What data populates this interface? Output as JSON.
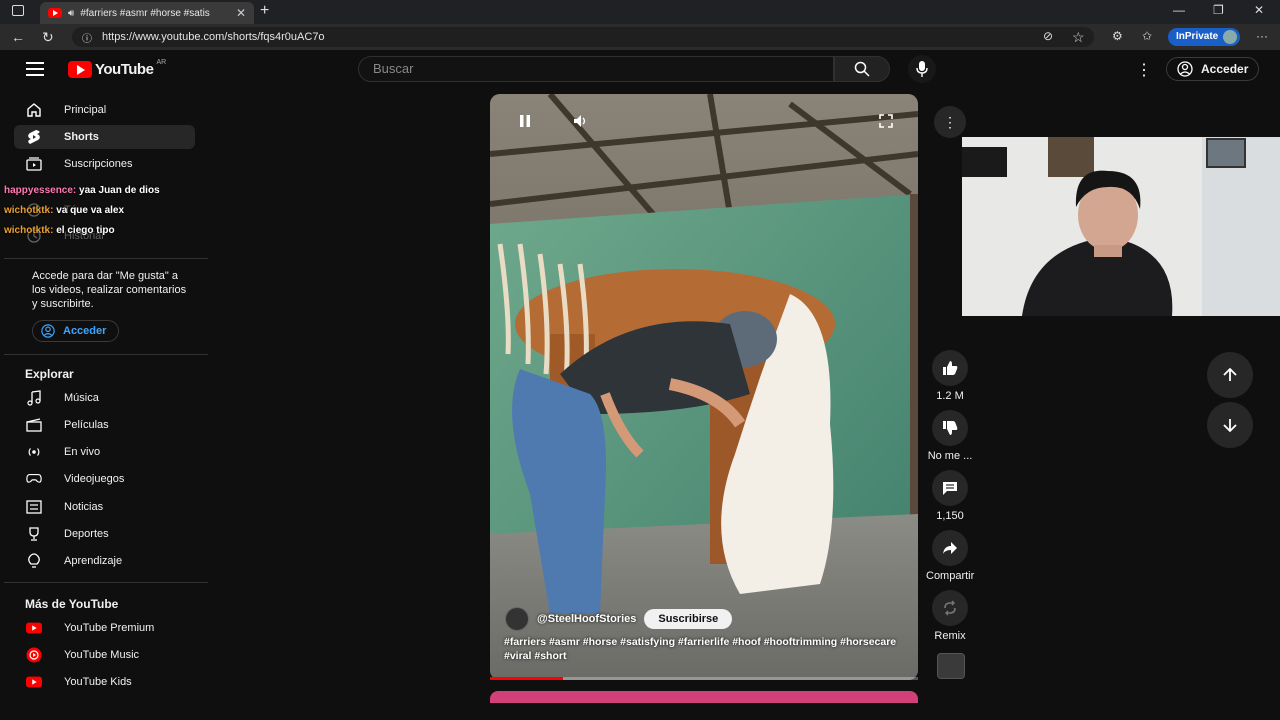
{
  "browser": {
    "tab_title": "#farriers #asmr #horse #satis",
    "url": "https://www.youtube.com/shorts/fqs4r0uAC7o",
    "inprivate_label": "InPrivate"
  },
  "header": {
    "logo_text": "YouTube",
    "country_code": "AR",
    "search_placeholder": "Buscar",
    "signin_label": "Acceder"
  },
  "sidebar": {
    "items": [
      {
        "label": "Principal",
        "icon": "home-icon"
      },
      {
        "label": "Shorts",
        "icon": "shorts-icon"
      },
      {
        "label": "Suscripciones",
        "icon": "subscriptions-icon"
      },
      {
        "label": "Tú",
        "icon": "you-icon"
      },
      {
        "label": "Historial",
        "icon": "history-icon"
      }
    ],
    "login_prompt": "Accede para dar \"Me gusta\" a los videos, realizar comentarios y suscribirte.",
    "login_button": "Acceder",
    "explore_title": "Explorar",
    "explore": [
      {
        "label": "Música",
        "icon": "music-icon"
      },
      {
        "label": "Películas",
        "icon": "movies-icon"
      },
      {
        "label": "En vivo",
        "icon": "live-icon"
      },
      {
        "label": "Videojuegos",
        "icon": "gaming-icon"
      },
      {
        "label": "Noticias",
        "icon": "news-icon"
      },
      {
        "label": "Deportes",
        "icon": "sports-icon"
      },
      {
        "label": "Aprendizaje",
        "icon": "learning-icon"
      }
    ],
    "more_title": "Más de YouTube",
    "more": [
      {
        "label": "YouTube Premium"
      },
      {
        "label": "YouTube Music"
      },
      {
        "label": "YouTube Kids"
      }
    ]
  },
  "chat": [
    {
      "user": "happyessence:",
      "message": "yaa Juan de dios"
    },
    {
      "user": "wichotktk:",
      "message": "va que va alex"
    },
    {
      "user": "wichotktk:",
      "message": "el ciego tipo"
    }
  ],
  "video": {
    "channel": "@SteelHoofStories",
    "subscribe_label": "Suscribirse",
    "caption": "#farriers #asmr #horse #satisfying #farrierlife #hoof #hooftrimming #horsecare #viral #short",
    "progress": 0.17
  },
  "actions": {
    "like_count": "1.2 M",
    "dislike_label": "No me ...",
    "comments_count": "1,150",
    "share_label": "Compartir",
    "remix_label": "Remix"
  },
  "colors": {
    "background": "#0f0f0f",
    "brand_red": "#ff0000",
    "link_blue": "#3ea6ff",
    "inprivate_blue": "#1a5fc8"
  }
}
